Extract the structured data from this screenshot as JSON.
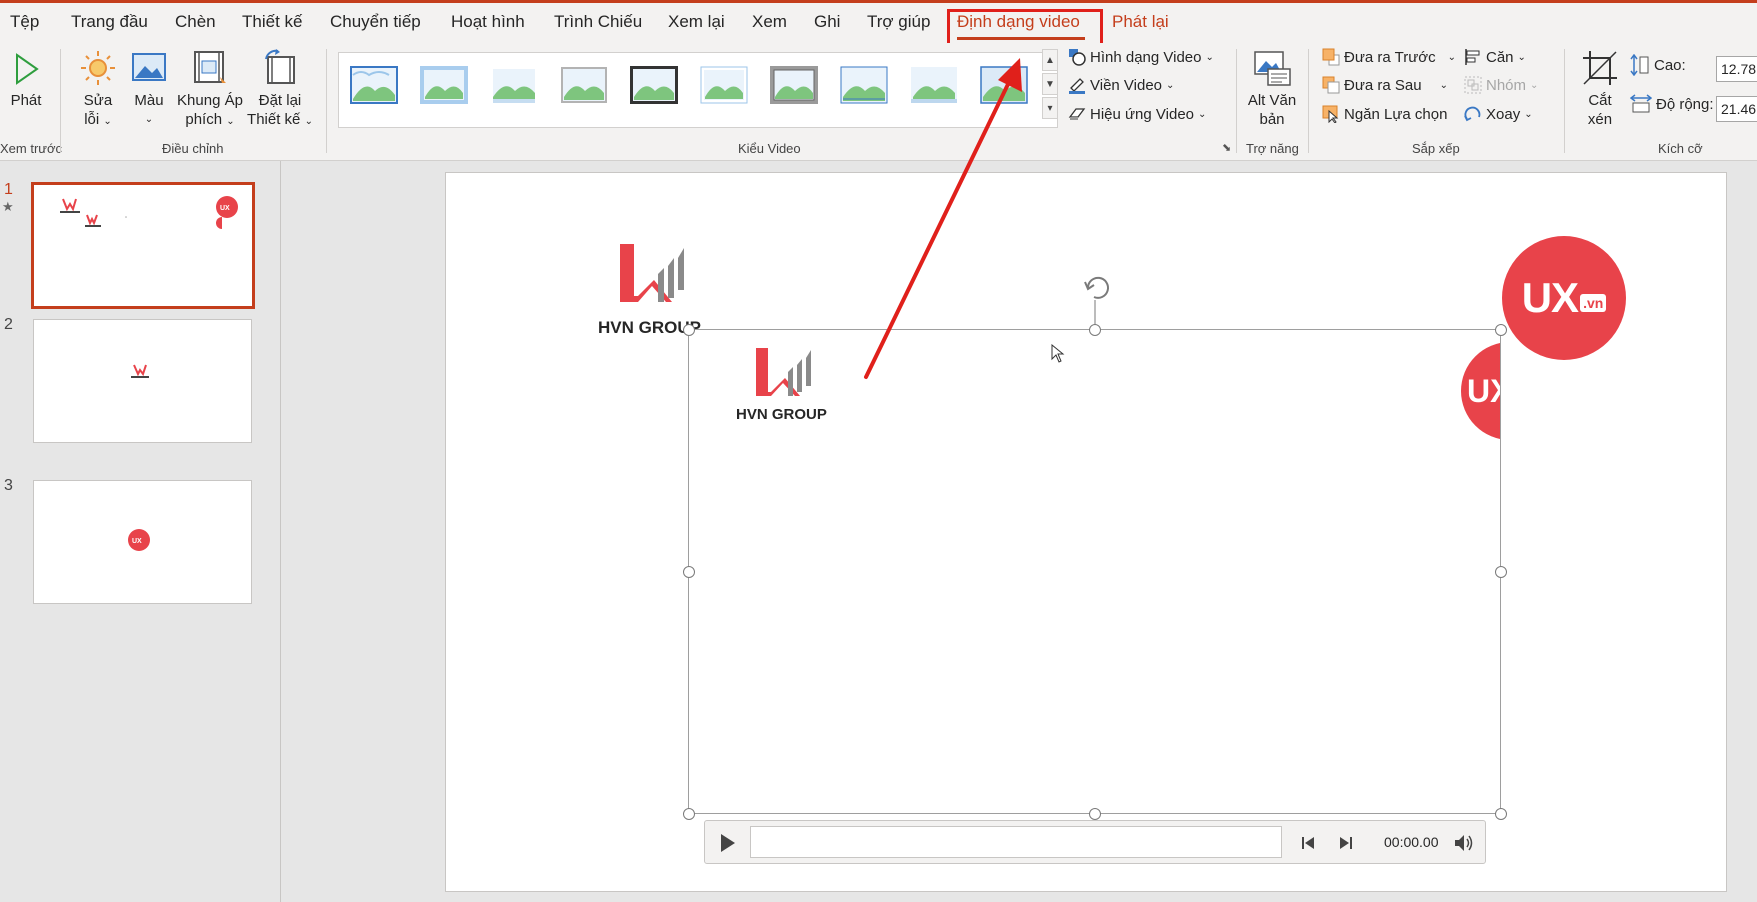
{
  "menu": {
    "tabs": [
      "Tệp",
      "Trang đầu",
      "Chèn",
      "Thiết kế",
      "Chuyển tiếp",
      "Hoạt hình",
      "Trình Chiếu",
      "Xem lại",
      "Xem",
      "Ghi",
      "Trợ giúp",
      "Định dạng video",
      "Phát lại"
    ],
    "active_tab": "Định dạng video"
  },
  "ribbon": {
    "preview": {
      "play_label": "Phát",
      "group": "Xem trước"
    },
    "adjust": {
      "corrections": [
        "Sửa",
        "lỗi"
      ],
      "color": "Màu",
      "poster": [
        "Khung Áp",
        "phích"
      ],
      "reset": [
        "Đặt lại",
        "Thiết kế"
      ],
      "group": "Điều chỉnh"
    },
    "styles": {
      "group": "Kiểu Video"
    },
    "video_options": {
      "shape": "Hình dạng Video",
      "border": "Viền Video",
      "effects": "Hiệu ứng Video"
    },
    "accessibility": {
      "alt_text": [
        "Alt Văn",
        "bản"
      ],
      "group": "Trợ năng"
    },
    "arrange": {
      "bring_forward": "Đưa ra Trước",
      "send_backward": "Đưa ra Sau",
      "selection_pane": "Ngăn Lựa chọn",
      "align": "Căn",
      "group_btn": "Nhóm",
      "rotate": "Xoay",
      "group": "Sắp xếp"
    },
    "size": {
      "crop": [
        "Cắt",
        "xén"
      ],
      "height_label": "Cao:",
      "height_value": "12.78",
      "width_label": "Độ rộng:",
      "width_value": "21.46",
      "group": "Kích cỡ"
    }
  },
  "slides": {
    "numbers": [
      "1",
      "2",
      "3"
    ],
    "star": "★"
  },
  "canvas": {
    "hvn_text": "HVN GROUP",
    "hvn_text_clipped": "HVN GROUP",
    "ux_text": "UX",
    "ux_suffix": ".vn",
    "ux_partial": "UX"
  },
  "player": {
    "time": "00:00.00"
  },
  "colors": {
    "accent": "#c43e1c",
    "highlight_box": "#e0201b",
    "brand_red": "#e8434a",
    "hvn_red": "#e8434a",
    "hvn_gray": "#8a8a8a"
  }
}
